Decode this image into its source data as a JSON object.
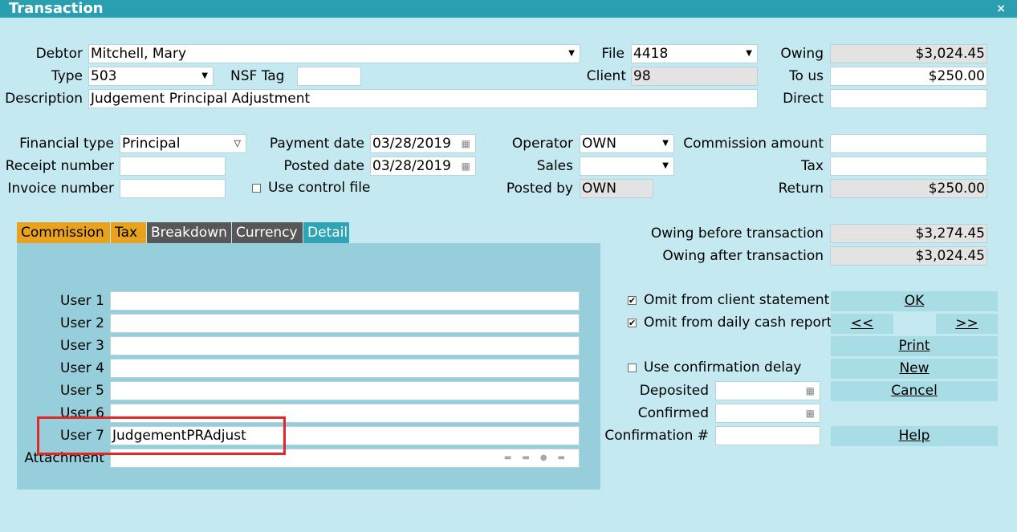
{
  "window": {
    "title": "Transaction",
    "close_symbol": "×"
  },
  "top": {
    "debtor_label": "Debtor",
    "debtor_value": "Mitchell, Mary",
    "type_label": "Type",
    "type_value": "503",
    "nsf_label": "NSF Tag",
    "nsf_value": "",
    "description_label": "Description",
    "description_value": "Judgement Principal Adjustment",
    "file_label": "File",
    "file_value": "4418",
    "client_label": "Client",
    "client_value": "98",
    "owing_label": "Owing",
    "owing_value": "$3,024.45",
    "to_us_label": "To us",
    "to_us_value": "$250.00",
    "direct_label": "Direct",
    "direct_value": ""
  },
  "mid": {
    "financial_type_label": "Financial type",
    "financial_type_value": "Principal",
    "receipt_label": "Receipt number",
    "receipt_value": "",
    "invoice_label": "Invoice number",
    "invoice_value": "",
    "payment_date_label": "Payment date",
    "payment_date_value": "03/28/2019",
    "posted_date_label": "Posted date",
    "posted_date_value": "03/28/2019",
    "use_control_file_label": "Use control file",
    "use_control_file_checked": false,
    "operator_label": "Operator",
    "operator_value": "OWN",
    "sales_label": "Sales",
    "sales_value": "",
    "posted_by_label": "Posted by",
    "posted_by_value": "OWN",
    "commission_amount_label": "Commission amount",
    "commission_amount_value": "",
    "tax_label": "Tax",
    "tax_value": "",
    "return_label": "Return",
    "return_value": "$250.00"
  },
  "tabs": [
    {
      "label": "Commission",
      "style": "orange"
    },
    {
      "label": "Tax",
      "style": "orange"
    },
    {
      "label": "Breakdown",
      "style": "dark"
    },
    {
      "label": "Currency",
      "style": "dark"
    },
    {
      "label": "Detail",
      "style": "active"
    }
  ],
  "detail": {
    "users": [
      {
        "label": "User 1",
        "value": ""
      },
      {
        "label": "User 2",
        "value": ""
      },
      {
        "label": "User 3",
        "value": ""
      },
      {
        "label": "User 4",
        "value": ""
      },
      {
        "label": "User 5",
        "value": ""
      },
      {
        "label": "User 6",
        "value": ""
      },
      {
        "label": "User 7",
        "value": "JudgementPRAdjust"
      }
    ],
    "attachment_label": "Attachment",
    "attachment_value": ""
  },
  "right": {
    "owing_before_label": "Owing before transaction",
    "owing_before_value": "$3,274.45",
    "owing_after_label": "Owing after transaction",
    "owing_after_value": "$3,024.45",
    "omit_client_label": "Omit from client statement",
    "omit_client_checked": true,
    "omit_daily_label": "Omit from daily cash report",
    "omit_daily_checked": true,
    "use_confirmation_delay_label": "Use confirmation delay",
    "use_confirmation_delay_checked": false,
    "deposited_label": "Deposited",
    "deposited_value": "",
    "confirmed_label": "Confirmed",
    "confirmed_value": "",
    "confirmation_no_label": "Confirmation #",
    "confirmation_no_value": ""
  },
  "buttons": {
    "ok": "OK",
    "prev": "<<",
    "next": ">>",
    "print": "Print",
    "new": "New",
    "cancel": "Cancel",
    "help": "Help"
  },
  "icons": {
    "dropdown": "dropdown-arrow-icon",
    "calendar": "calendar-icon",
    "checkmark": "✔"
  },
  "colors": {
    "background": "#c4e9f0",
    "titlebar": "#2a9fb0",
    "tab_orange": "#e8a21e",
    "tab_dark": "#575757",
    "tab_active": "#2ea4b5",
    "panel": "#96cfdb",
    "button": "#a9dde6",
    "highlight": "#e32727"
  }
}
